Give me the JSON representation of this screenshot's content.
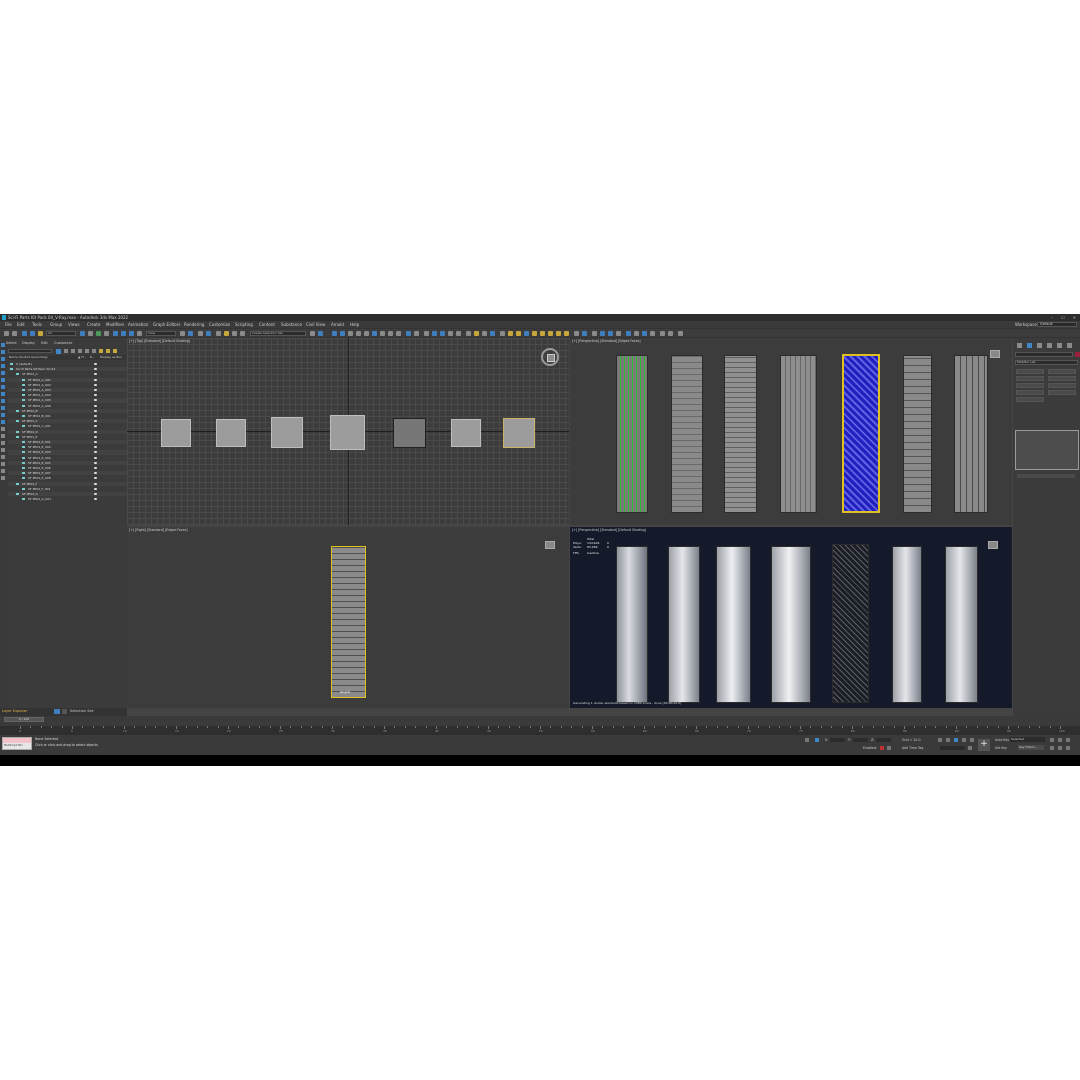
{
  "title": "Sci-Fi Parts Kit Pack 04_V-Ray.max - Autodesk 3ds Max 2022",
  "window_buttons": [
    "–",
    "☐",
    "✕"
  ],
  "menu": [
    "File",
    "Edit",
    "Tools",
    "Group",
    "Views",
    "Create",
    "Modifiers",
    "Animation",
    "Graph Editors",
    "Rendering",
    "Customize",
    "Scripting",
    "Content",
    "Substance",
    "Civil View",
    "Arnold",
    "Help"
  ],
  "workspaces_label": "Workspaces:",
  "workspace_value": "Default",
  "toolbar": {
    "selection_filter": "All",
    "view_dropdown": "View",
    "named_selection": "Create Selection Set"
  },
  "scene_explorer": {
    "tabs": [
      "Select",
      "Display",
      "Edit",
      "Customize"
    ],
    "columns": [
      "Name (Sorted Ascending)",
      "▲ Fr...",
      "R...",
      "Display as Box"
    ],
    "rows": [
      {
        "name": "0 (default)",
        "indent": 1
      },
      {
        "name": "Sci-Fi Parts Kit Pack Vol 04",
        "indent": 1
      },
      {
        "name": "SF PP04_A",
        "indent": 2
      },
      {
        "name": "SF PP04_A_001",
        "indent": 3
      },
      {
        "name": "SF PP04_A_002",
        "indent": 3
      },
      {
        "name": "SF PP04_A_003",
        "indent": 3
      },
      {
        "name": "SF PP04_A_004",
        "indent": 3
      },
      {
        "name": "SF PP04_A_005",
        "indent": 3
      },
      {
        "name": "SF PP04_A_006",
        "indent": 3
      },
      {
        "name": "SF PP04_B",
        "indent": 2
      },
      {
        "name": "SF PP04_B_001",
        "indent": 3
      },
      {
        "name": "SF PP04_C",
        "indent": 2
      },
      {
        "name": "SF PP04_C_001",
        "indent": 3
      },
      {
        "name": "SF PP04_D",
        "indent": 2
      },
      {
        "name": "SF PP04_E",
        "indent": 2
      },
      {
        "name": "SF PP04_E_001",
        "indent": 3
      },
      {
        "name": "SF PP04_E_002",
        "indent": 3
      },
      {
        "name": "SF PP04_E_003",
        "indent": 3
      },
      {
        "name": "SF PP04_E_004",
        "indent": 3
      },
      {
        "name": "SF PP04_E_005",
        "indent": 3
      },
      {
        "name": "SF PP04_E_006",
        "indent": 3
      },
      {
        "name": "SF PP04_E_007",
        "indent": 3
      },
      {
        "name": "SF PP04_E_008",
        "indent": 3
      },
      {
        "name": "SF PP04_F",
        "indent": 2
      },
      {
        "name": "SF PP04_F_001",
        "indent": 3
      },
      {
        "name": "SF PP04_G",
        "indent": 2
      },
      {
        "name": "SF PP04_G_001",
        "indent": 3
      }
    ],
    "layer_explorer": "Layer Explorer",
    "selection_set": "Selection Set:"
  },
  "viewports": {
    "top": "[+] [Top] [Standard] [Default Shading]",
    "perspective1": "[+] [Perspective] [Standard] [Edged Faces]",
    "right": "[+] [Right] [Standard] [Edged Faces]",
    "perspective2": "[+] [Perspective] [Standard] [Default Shading]",
    "right_object_label": "[Right]",
    "stats": {
      "total_label": "Total",
      "polys_label": "Polys:",
      "polys_value": "144,626",
      "polys_sel": "0",
      "verts_label": "Verts:",
      "verts_value": "83,286",
      "verts_sel": "0",
      "fps_label": "FPS:",
      "fps_value": "Inactive"
    },
    "status_message": "Generating 1 render elements based on 1080 scans - done [00:00:00.0]"
  },
  "command_panel": {
    "modifier_list": "Modifier List",
    "buttons": [
      "Edit Poly",
      "Unwrap UVW",
      "Chamfer",
      "Smooth",
      "Turbosmooth",
      "Shell",
      "Symmetry",
      "FFD 4x4x4",
      "Sweep",
      "Noise"
    ]
  },
  "timeline": {
    "frame_slider": "0 / 100"
  },
  "ruler_ticks": [
    "0",
    "5",
    "10",
    "15",
    "20",
    "25",
    "30",
    "35",
    "40",
    "45",
    "50",
    "55",
    "60",
    "65",
    "70",
    "75",
    "80",
    "85",
    "90",
    "95",
    "100"
  ],
  "status": {
    "selection": "None Selected",
    "prompt": "Click or click-and-drag to select objects",
    "maxscript": "MAXScript Mini",
    "x_label": "X:",
    "y_label": "Y:",
    "z_label": "Z:",
    "grid": "Grid = 10.0",
    "add_time_tag": "Add Time Tag",
    "enabled": "Enabled:",
    "auto_key": "Auto Key",
    "set_key": "Set Key",
    "selected": "Selected",
    "key_filters": "Key Filters..."
  },
  "colors": {
    "accent": "#3f86c7",
    "selection_yellow": "#e0c020",
    "wire_green": "#30c030",
    "wire_blue": "#2020c0",
    "persp_bg": "#141a29"
  }
}
